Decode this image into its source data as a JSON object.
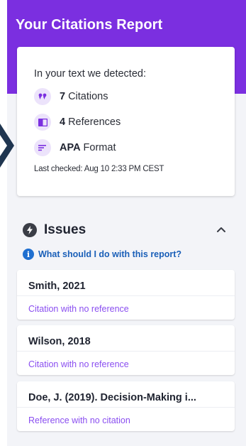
{
  "header": {
    "title": "Your Citations Report"
  },
  "summary": {
    "intro": "In your text we detected:",
    "stats": [
      {
        "icon": "quote-icon",
        "number": "7",
        "label": "Citations"
      },
      {
        "icon": "book-icon",
        "number": "4",
        "label": "References"
      },
      {
        "icon": "lines-icon",
        "number": "APA",
        "label": "Format"
      }
    ],
    "last_checked": "Last checked: Aug 10 2:33 PM CEST"
  },
  "issues": {
    "title": "Issues",
    "help_link": "What should I do with this report?",
    "items": [
      {
        "title": "Smith, 2021",
        "subtitle": "Citation with no reference"
      },
      {
        "title": "Wilson, 2018",
        "subtitle": "Citation with no reference"
      },
      {
        "title": "Doe, J. (2019). Decision-Making i...",
        "subtitle": "Reference with no citation"
      }
    ]
  },
  "colors": {
    "brand_purple": "#7b2fe0",
    "link_blue": "#1a5fb8",
    "issue_subtitle_purple": "#8a4ef0",
    "icon_bg": "#ece3fb"
  }
}
